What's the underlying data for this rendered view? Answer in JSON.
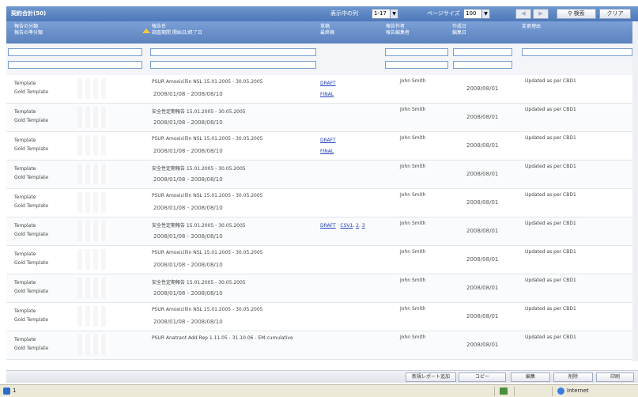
{
  "toolbar": {
    "title": "契約合計(50)",
    "display_label": "表示中の列",
    "display_value": "1-17",
    "pagesize_label": "ページサイズ",
    "pagesize_value": "100",
    "prev_label": "◀",
    "next_label": "▶",
    "search_label": "検索",
    "clear_label": "クリア"
  },
  "columns": {
    "category": [
      "報告の分類",
      "報告の準分類"
    ],
    "report": [
      "報告名",
      "調査期間  開始日/終了日"
    ],
    "draft": [
      "草稿",
      "最終稿"
    ],
    "author": [
      "報告作者",
      "報告編集者"
    ],
    "created": [
      "作成日",
      "編集日"
    ],
    "reason": "変更理由"
  },
  "rows": [
    {
      "cat1": "Template",
      "cat2": "Gold Template",
      "name": "PSUR Amoxicillin NSL 15.01.2005 - 30.05.2005",
      "period": "2008/01/08  -  2008/08/10",
      "links": [
        "DRAFT",
        "FINAL"
      ],
      "author": "John Smith",
      "date": "2008/08/01",
      "reason": "Updated as per CBD1"
    },
    {
      "cat1": "Template",
      "cat2": "Gold Template",
      "name": "安全性定期報告      15.01.2005 - 30.05.2005",
      "period": "2008/01/08  -  2008/08/10",
      "links": [],
      "author": "John Smith",
      "date": "2008/08/01",
      "reason": "Updated as per CBD1"
    },
    {
      "cat1": "Template",
      "cat2": "Gold Template",
      "name": "PSUR Amoxicillin NSL 15.01.2005 - 30.05.2005",
      "period": "2008/01/08  -  2008/08/10",
      "links": [
        "DRAFT",
        "FINAL"
      ],
      "author": "John Smith",
      "date": "2008/08/01",
      "reason": "Updated as per CBD1"
    },
    {
      "cat1": "Template",
      "cat2": "Gold Template",
      "name": "安全性定期報告      15.01.2005 - 30.05.2005",
      "period": "2008/01/08  -  2008/08/10",
      "links": [],
      "author": "John Smith",
      "date": "2008/08/01",
      "reason": "Updated as per CBD1"
    },
    {
      "cat1": "Template",
      "cat2": "Gold Template",
      "name": "PSUR Amoxicillin NSL 15.01.2005 - 30.05.2005",
      "period": "2008/01/08  -  2008/08/10",
      "links": [],
      "author": "John Smith",
      "date": "2008/08/01",
      "reason": "Updated as per CBD1"
    },
    {
      "cat1": "Template",
      "cat2": "Gold Template",
      "name": "安全性定期報告      15.01.2005 - 30.05.2005",
      "period": "2008/01/08  -  2008/08/10",
      "links": [
        "DRAFT",
        "CSV1",
        "2",
        "3"
      ],
      "author": "John Smith",
      "date": "2008/08/01",
      "reason": "Updated as per CBD1"
    },
    {
      "cat1": "Template",
      "cat2": "Gold Template",
      "name": "PSUR Amoxicillin NSL 15.01.2005 - 30.05.2005",
      "period": "2008/01/08  -  2008/08/10",
      "links": [],
      "author": "John Smith",
      "date": "2008/08/01",
      "reason": "Updated as per CBD1"
    },
    {
      "cat1": "Template",
      "cat2": "Gold Template",
      "name": "安全性定期報告      15.01.2005 - 30.05.2005",
      "period": "2008/01/08  -  2008/08/10",
      "links": [],
      "author": "John Smith",
      "date": "2008/08/01",
      "reason": "Updated as per CBD1"
    },
    {
      "cat1": "Template",
      "cat2": "Gold Template",
      "name": "PSUR Amoxicillin NSL 15.01.2005 - 30.05.2005",
      "period": "2008/01/08  -  2008/08/10",
      "links": [],
      "author": "John Smith",
      "date": "2008/08/01",
      "reason": "Updated as per CBD1"
    },
    {
      "cat1": "Template",
      "cat2": "Gold Template",
      "name": "PSUR Anatrant Add Rep 1.11.05 - 31.10.06 - EM cumulative",
      "period": "",
      "links": [],
      "author": "John Smith",
      "date": "2008/08/01",
      "reason": "Updated as per CBD1"
    }
  ],
  "bottom": {
    "add_label": "新規レポート追加",
    "copy_label": "コピー",
    "edit_label": "編集",
    "delete_label": "削除",
    "print_label": "印刷"
  },
  "status": {
    "page_text": "1",
    "zone_text": "Internet"
  },
  "colors": {
    "header": "#5b82bf",
    "link": "#1f3fb8"
  }
}
